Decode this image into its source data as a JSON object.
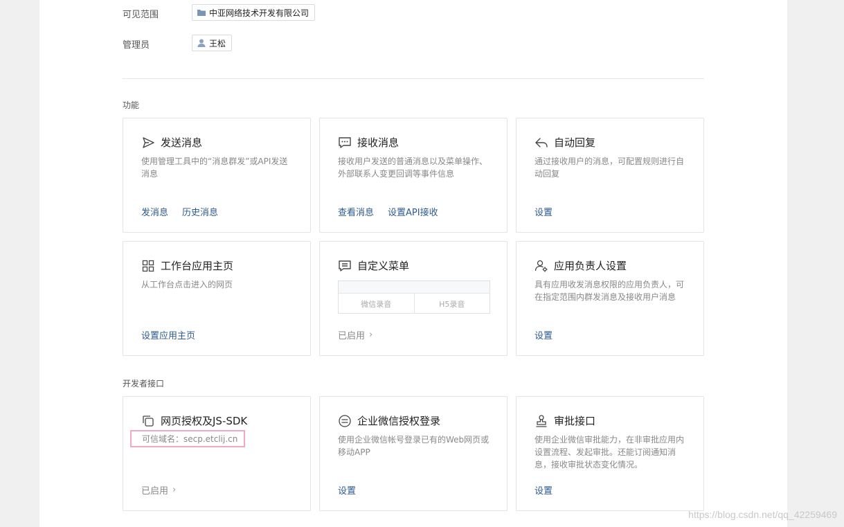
{
  "visibility": {
    "label": "可见范围",
    "value": "中亚网络技术开发有限公司",
    "icon": "folder-icon"
  },
  "admin": {
    "label": "管理员",
    "value": "王松",
    "icon": "user-icon"
  },
  "sections": {
    "features": "功能",
    "developer": "开发者接口"
  },
  "cards": {
    "send": {
      "title": "发送消息",
      "icon": "send-icon",
      "desc": "使用管理工具中的“消息群发”或API发送消息",
      "links": [
        "发消息",
        "历史消息"
      ]
    },
    "receive": {
      "title": "接收消息",
      "icon": "chat-icon",
      "desc": "接收用户发送的普通消息以及菜单操作、外部联系人变更回调等事件信息",
      "links": [
        "查看消息",
        "设置API接收"
      ]
    },
    "autoreply": {
      "title": "自动回复",
      "icon": "reply-icon",
      "desc": "通过接收用户的消息，可配置规则进行自动回复",
      "links": [
        "设置"
      ]
    },
    "workbench": {
      "title": "工作台应用主页",
      "icon": "grid-icon",
      "desc": "从工作台点击进入的网页",
      "links": [
        "设置应用主页"
      ]
    },
    "menu": {
      "title": "自定义菜单",
      "icon": "menu-icon",
      "preview": [
        "微信录音",
        "H5录音"
      ],
      "status": "已启用"
    },
    "owner": {
      "title": "应用负责人设置",
      "icon": "person-settings-icon",
      "desc": "具有应用收发消息权限的应用负责人，可在指定范围内群发消息及接收用户消息",
      "links": [
        "设置"
      ]
    },
    "oauth": {
      "title": "网页授权及JS-SDK",
      "icon": "copy-icon",
      "domain": "可信域名：secp.etclij.cn",
      "status": "已启用"
    },
    "wxlogin": {
      "title": "企业微信授权登录",
      "icon": "login-icon",
      "desc": "使用企业微信帐号登录已有的Web网页或移动APP",
      "links": [
        "设置"
      ]
    },
    "approval": {
      "title": "审批接口",
      "icon": "stamp-icon",
      "desc": "使用企业微信审批能力，在非审批应用内设置流程、发起审批。还能订阅通知消息，接收审批状态变化情况。",
      "links": [
        "设置"
      ]
    }
  },
  "watermark": "https://blog.csdn.net/qq_42259469"
}
